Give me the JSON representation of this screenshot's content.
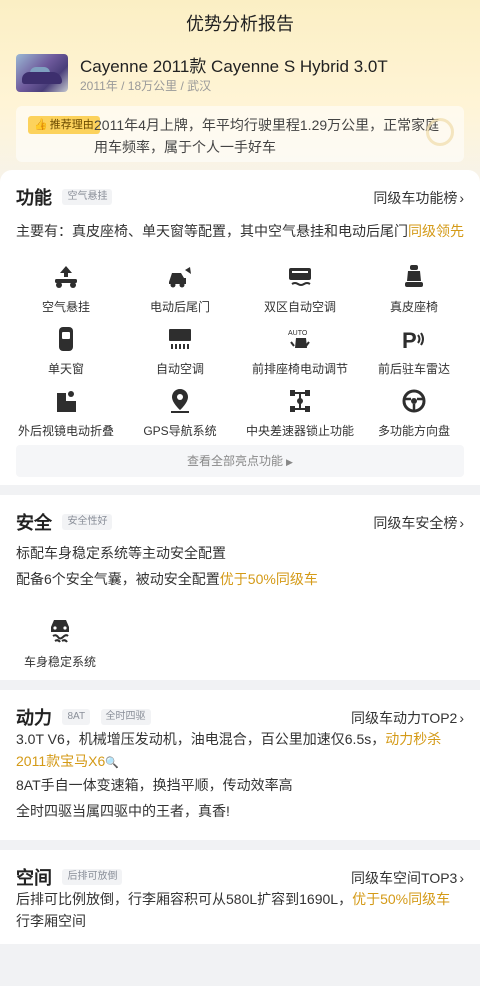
{
  "header": {
    "title": "优势分析报告"
  },
  "car": {
    "name": "Cayenne 2011款 Cayenne S Hybrid 3.0T",
    "meta": "2011年 / 18万公里 / 武汉"
  },
  "reason": {
    "tag_label": "推荐理由",
    "text": "2011年4月上牌，年平均行驶里程1.29万公里，正常家庭用车频率，属于个人一手好车"
  },
  "function": {
    "title": "功能",
    "tag": "空气悬挂",
    "link": "同级车功能榜",
    "summary_prefix": "主要有：真皮座椅、单天窗等配置，其中空气悬挂和电动后尾门",
    "summary_highlight": "同级领先",
    "features": [
      {
        "label": "空气悬挂",
        "icon": "air-suspension-icon"
      },
      {
        "label": "电动后尾门",
        "icon": "power-tailgate-icon"
      },
      {
        "label": "双区自动空调",
        "icon": "dual-zone-ac-icon"
      },
      {
        "label": "真皮座椅",
        "icon": "leather-seat-icon"
      },
      {
        "label": "单天窗",
        "icon": "sunroof-icon"
      },
      {
        "label": "自动空调",
        "icon": "auto-ac-icon"
      },
      {
        "label": "前排座椅电动调节",
        "icon": "power-seat-icon"
      },
      {
        "label": "前后驻车雷达",
        "icon": "parking-radar-icon"
      },
      {
        "label": "外后视镜电动折叠",
        "icon": "mirror-fold-icon"
      },
      {
        "label": "GPS导航系统",
        "icon": "gps-icon"
      },
      {
        "label": "中央差速器锁止功能",
        "icon": "diff-lock-icon"
      },
      {
        "label": "多功能方向盘",
        "icon": "steering-wheel-icon"
      }
    ],
    "see_all": "查看全部亮点功能"
  },
  "safety": {
    "title": "安全",
    "tag": "安全性好",
    "link": "同级车安全榜",
    "line1": "标配车身稳定系统等主动安全配置",
    "line2_prefix": "配备6个安全气囊，被动安全配置",
    "line2_highlight": "优于50%同级车",
    "feature": {
      "label": "车身稳定系统",
      "icon": "stability-control-icon"
    }
  },
  "power": {
    "title": "动力",
    "tags": [
      "8AT",
      "全时四驱"
    ],
    "link": "同级车动力TOP2",
    "line1_prefix": "3.0T V6，机械增压发动机，油电混合，百公里加速仅6.5s，",
    "line1_highlight": "动力秒杀 2011款宝马X6",
    "line2": "8AT手自一体变速箱，换挡平顺，传动效率高",
    "line3": "全时四驱当属四驱中的王者，真香!"
  },
  "space": {
    "title": "空间",
    "tag": "后排可放倒",
    "link": "同级车空间TOP3",
    "text_prefix": "后排可比例放倒，行李厢容积可从580L扩容到1690L，",
    "text_highlight": "优于50%同级车",
    "text_suffix": "行李厢空间"
  },
  "colors": {
    "accent": "#D49A17",
    "tag_bg": "#FCD25C",
    "banner": "#FBEFC4"
  }
}
